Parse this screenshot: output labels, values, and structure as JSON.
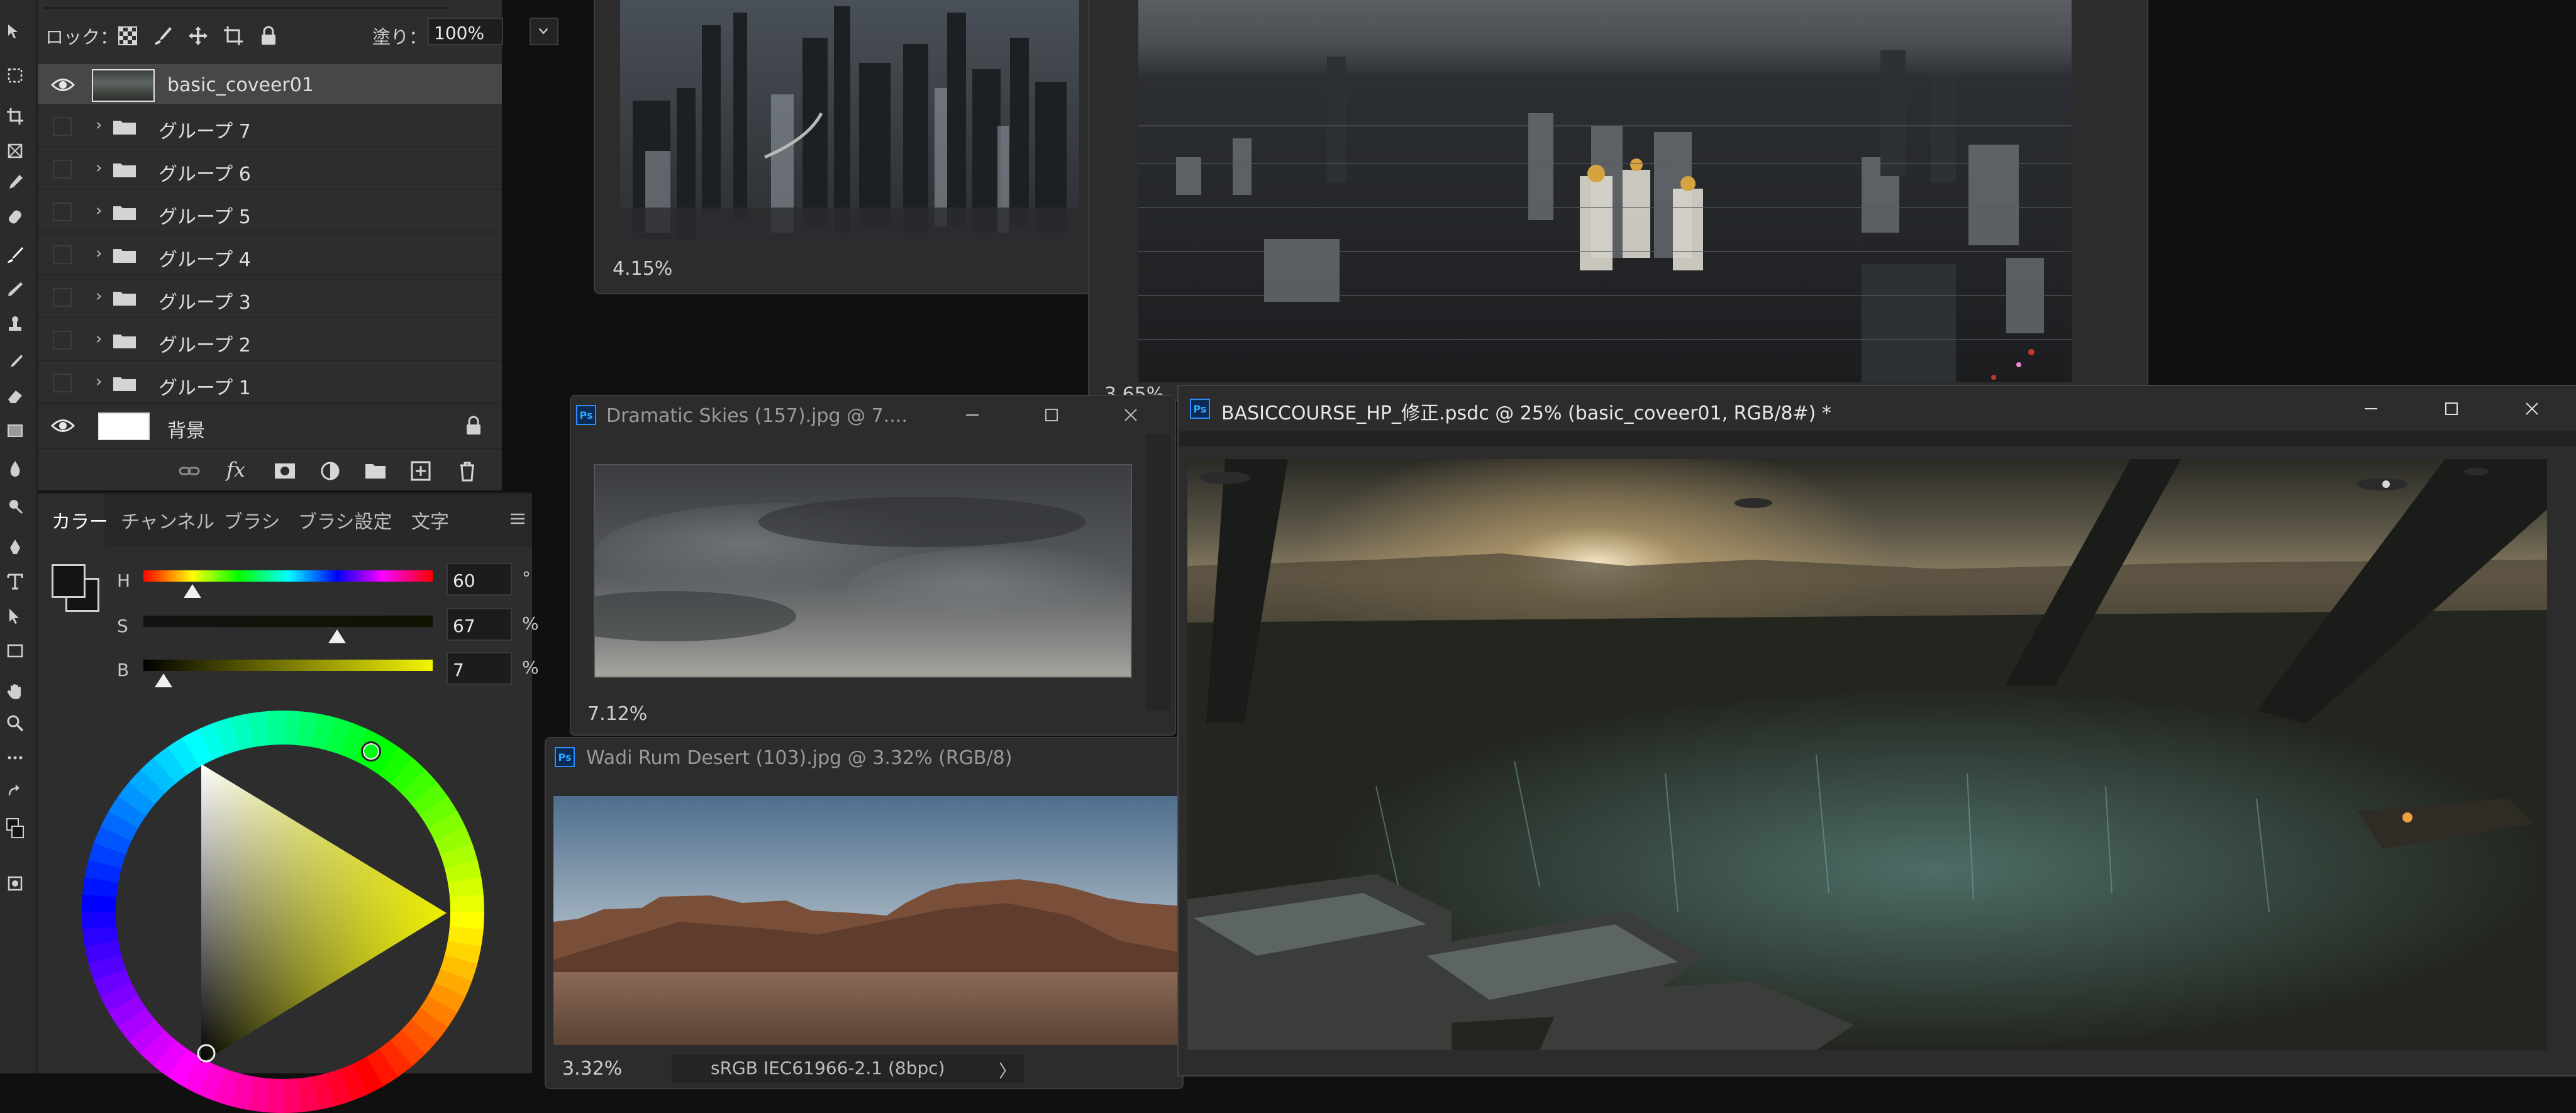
{
  "layers_panel": {
    "lock_label": "ロック：",
    "fill_label": "塗り：",
    "fill_value": "100%",
    "layers": [
      {
        "name": "basic_coveer01",
        "visible": true,
        "selected": true,
        "type": "image"
      },
      {
        "name": "グループ 7",
        "visible": false,
        "type": "group"
      },
      {
        "name": "グループ 6",
        "visible": false,
        "type": "group"
      },
      {
        "name": "グループ 5",
        "visible": false,
        "type": "group"
      },
      {
        "name": "グループ 4",
        "visible": false,
        "type": "group"
      },
      {
        "name": "グループ 3",
        "visible": false,
        "type": "group"
      },
      {
        "name": "グループ 2",
        "visible": false,
        "type": "group"
      },
      {
        "name": "グループ 1",
        "visible": false,
        "type": "group"
      },
      {
        "name": "背景",
        "visible": true,
        "type": "background",
        "locked": true
      }
    ],
    "footer_fx": "fx"
  },
  "color_panel": {
    "tabs": [
      "カラー",
      "チャンネル",
      "ブラシ",
      "ブラシ設定",
      "文字"
    ],
    "active_tab": "カラー",
    "h": {
      "label": "H",
      "value": "60",
      "unit": "°",
      "fraction": 0.17
    },
    "s": {
      "label": "S",
      "value": "67",
      "unit": "%",
      "fraction": 0.67
    },
    "b": {
      "label": "B",
      "value": "7",
      "unit": "%",
      "fraction": 0.07
    },
    "hue_color": "#f0f000"
  },
  "windows": {
    "city_small": {
      "zoom": "4.15%"
    },
    "city_large": {
      "zoom": "3.65%"
    },
    "skies": {
      "title": "Dramatic Skies (157).jpg @ 7....",
      "zoom": "7.12%"
    },
    "desert": {
      "title": "Wadi Rum Desert (103).jpg @ 3.32% (RGB/8)",
      "zoom": "3.32%",
      "profile": "sRGB IEC61966-2.1 (8bpc)",
      "profile_arrow": "〉"
    },
    "main": {
      "title": "BASICCOURSE_HP_修正.psdc @ 25% (basic_coveer01, RGB/8#) *"
    }
  },
  "ps_badge": "Ps"
}
